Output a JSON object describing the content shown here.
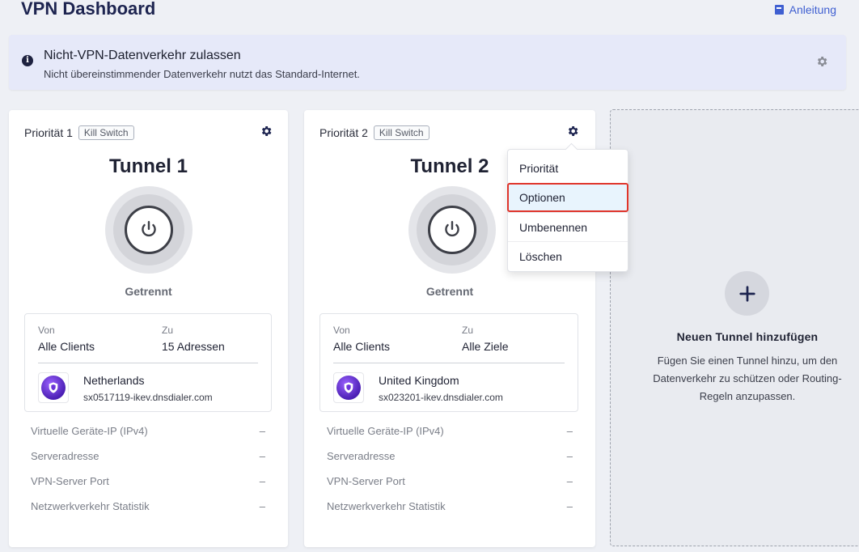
{
  "header": {
    "title": "VPN Dashboard",
    "guide_link": "Anleitung"
  },
  "banner": {
    "title": "Nicht-VPN-Datenverkehr zulassen",
    "subtitle": "Nicht übereinstimmender Datenverkehr nutzt das Standard-Internet."
  },
  "tunnels": [
    {
      "priority": "Priorität 1",
      "kill_switch": "Kill Switch",
      "name": "Tunnel 1",
      "status": "Getrennt",
      "from_label": "Von",
      "from_value": "Alle Clients",
      "to_label": "Zu",
      "to_value": "15 Adressen",
      "server_country": "Netherlands",
      "server_host": "sx0517119-ikev.dnsdialer.com",
      "stats": [
        {
          "label": "Virtuelle Geräte-IP (IPv4)",
          "value": "–"
        },
        {
          "label": "Serveradresse",
          "value": "–"
        },
        {
          "label": "VPN-Server Port",
          "value": "–"
        },
        {
          "label": "Netzwerkverkehr Statistik",
          "value": "–"
        }
      ]
    },
    {
      "priority": "Priorität 2",
      "kill_switch": "Kill Switch",
      "name": "Tunnel 2",
      "status": "Getrennt",
      "from_label": "Von",
      "from_value": "Alle Clients",
      "to_label": "Zu",
      "to_value": "Alle Ziele",
      "server_country": "United Kingdom",
      "server_host": "sx023201-ikev.dnsdialer.com",
      "stats": [
        {
          "label": "Virtuelle Geräte-IP (IPv4)",
          "value": "–"
        },
        {
          "label": "Serveradresse",
          "value": "–"
        },
        {
          "label": "VPN-Server Port",
          "value": "–"
        },
        {
          "label": "Netzwerkverkehr Statistik",
          "value": "–"
        }
      ]
    }
  ],
  "dropdown": {
    "items": [
      "Priorität",
      "Optionen",
      "Umbenennen",
      "Löschen"
    ],
    "highlighted": "Optionen"
  },
  "add_tunnel": {
    "title": "Neuen Tunnel hinzufügen",
    "description": "Fügen Sie einen Tunnel hinzu, um den Datenverkehr zu schützen oder Routing-Regeln anzupassen."
  },
  "colors": {
    "accent": "#3f5fd1",
    "title": "#1d2450",
    "highlight_border": "#e0352b",
    "shield": "#6b35d9"
  }
}
